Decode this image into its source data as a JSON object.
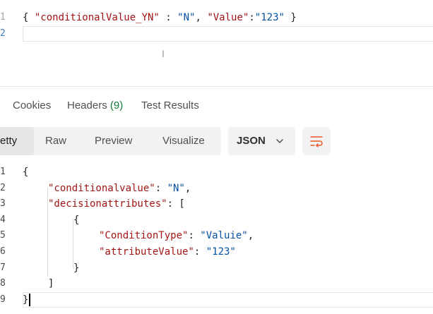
{
  "request_editor": {
    "lines": [
      {
        "num": "1",
        "parts": [
          {
            "t": "{ ",
            "c": "p"
          },
          {
            "t": "\"conditionalValue_YN\"",
            "c": "k"
          },
          {
            "t": " : ",
            "c": "p"
          },
          {
            "t": "\"N\"",
            "c": "s"
          },
          {
            "t": ", ",
            "c": "p"
          },
          {
            "t": "\"Value\"",
            "c": "k"
          },
          {
            "t": ":",
            "c": "p"
          },
          {
            "t": "\"123\"",
            "c": "s"
          },
          {
            "t": " }",
            "c": "p"
          }
        ]
      },
      {
        "num": "2",
        "parts": []
      }
    ]
  },
  "response_tabs": {
    "cookies": "Cookies",
    "headers": "Headers",
    "headers_count": "(9)",
    "test_results": "Test Results"
  },
  "toolbar": {
    "pretty": "etty",
    "raw": "Raw",
    "preview": "Preview",
    "visualize": "Visualize",
    "format": "JSON"
  },
  "response_body": {
    "lines": [
      {
        "num": "1",
        "indent": 0,
        "parts": [
          {
            "t": "{",
            "c": "p"
          }
        ]
      },
      {
        "num": "2",
        "indent": 1,
        "parts": [
          {
            "t": "\"conditionalvalue\"",
            "c": "k"
          },
          {
            "t": ": ",
            "c": "p"
          },
          {
            "t": "\"N\"",
            "c": "s"
          },
          {
            "t": ",",
            "c": "p"
          }
        ]
      },
      {
        "num": "3",
        "indent": 1,
        "parts": [
          {
            "t": "\"decisionattributes\"",
            "c": "k"
          },
          {
            "t": ": [",
            "c": "p"
          }
        ]
      },
      {
        "num": "4",
        "indent": 2,
        "parts": [
          {
            "t": "{",
            "c": "p"
          }
        ]
      },
      {
        "num": "5",
        "indent": 3,
        "parts": [
          {
            "t": "\"ConditionType\"",
            "c": "k"
          },
          {
            "t": ": ",
            "c": "p"
          },
          {
            "t": "\"Valuie\"",
            "c": "s"
          },
          {
            "t": ",",
            "c": "p"
          }
        ]
      },
      {
        "num": "6",
        "indent": 3,
        "parts": [
          {
            "t": "\"attributeValue\"",
            "c": "k"
          },
          {
            "t": ": ",
            "c": "p"
          },
          {
            "t": "\"123\"",
            "c": "s"
          }
        ]
      },
      {
        "num": "7",
        "indent": 2,
        "parts": [
          {
            "t": "}",
            "c": "p"
          }
        ]
      },
      {
        "num": "8",
        "indent": 1,
        "parts": [
          {
            "t": "]",
            "c": "p"
          }
        ]
      },
      {
        "num": "9",
        "indent": 0,
        "parts": [
          {
            "t": "}",
            "c": "p"
          }
        ]
      }
    ]
  },
  "colors": {
    "key": "#a31515",
    "string": "#0451a5",
    "accent": "#e8572b",
    "headers_count": "#0f7a3b"
  },
  "icons": {
    "format_dropdown": "chevron-down-icon",
    "wrap": "wrap-lines-icon"
  }
}
